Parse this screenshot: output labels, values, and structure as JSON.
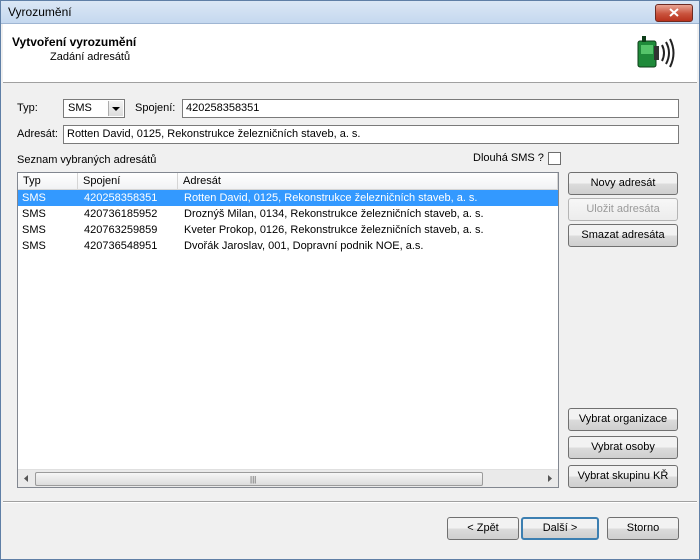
{
  "window": {
    "title": "Vyrozumění"
  },
  "header": {
    "title": "Vytvoření vyrozumění",
    "subtitle": "Zadání adresátů",
    "icon": "phone-signal-icon"
  },
  "form": {
    "typ_label": "Typ:",
    "typ_value": "SMS",
    "spojeni_label": "Spojení:",
    "spojeni_value": "420258358351",
    "adresat_label": "Adresát:",
    "adresat_value": "Rotten David, 0125, Rekonstrukce železničních staveb, a. s.",
    "list_label": "Seznam vybraných adresátů",
    "dlouha_sms_label": "Dlouhá SMS ?",
    "dlouha_sms_checked": false
  },
  "table": {
    "columns": [
      "Typ",
      "Spojení",
      "Adresát"
    ],
    "rows": [
      {
        "typ": "SMS",
        "spojeni": "420258358351",
        "adresat": "Rotten David, 0125, Rekonstrukce železničních staveb, a. s.",
        "selected": true
      },
      {
        "typ": "SMS",
        "spojeni": "420736185952",
        "adresat": "Droznýš Milan, 0134, Rekonstrukce železničních staveb, a. s.",
        "selected": false
      },
      {
        "typ": "SMS",
        "spojeni": "420763259859",
        "adresat": "Kveter Prokop, 0126, Rekonstrukce železničních staveb, a. s.",
        "selected": false
      },
      {
        "typ": "SMS",
        "spojeni": "420736548951",
        "adresat": "Dvořák Jaroslav, 001, Dopravní podnik NOE, a.s.",
        "selected": false
      }
    ]
  },
  "buttons": {
    "novy": "Novy adresát",
    "ulozit": "Uložit adresáta",
    "smazat": "Smazat adresáta",
    "vybrat_organizace": "Vybrat organizace",
    "vybrat_osoby": "Vybrat osoby",
    "vybrat_skupinu": "Vybrat skupinu KŘ",
    "zpet": "< Zpět",
    "dalsi": "Další >",
    "storno": "Storno"
  },
  "colors": {
    "selection": "#3399ff",
    "title_bar": "#c5d8ef",
    "close": "#c9533d"
  }
}
